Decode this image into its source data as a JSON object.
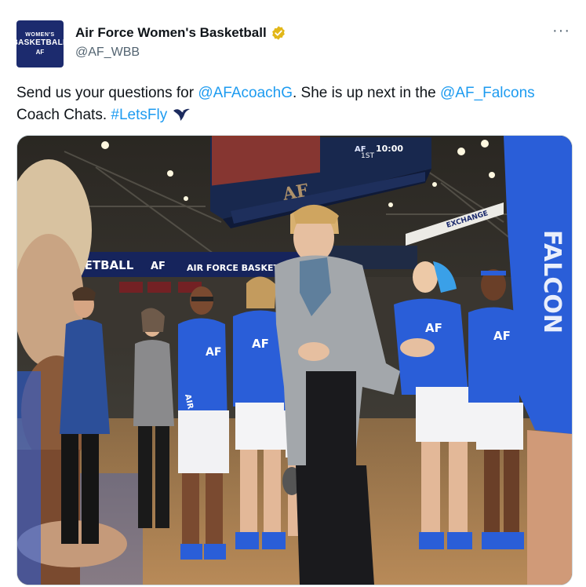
{
  "account": {
    "display_name": "Air Force Women's Basketball",
    "handle": "@AF_WBB",
    "verified": true,
    "avatar": {
      "line1": "WOMEN'S",
      "line2": "BASKETBALL",
      "line3": "AF"
    }
  },
  "tweet": {
    "text_1": "Send us your questions for ",
    "mention_1": "@AFAcoachG",
    "text_2": ". She is up next in the ",
    "mention_2": "@AF_Falcons",
    "text_3": " Coach Chats. ",
    "hashtag": "#LetsFly"
  },
  "media": {
    "scoreboard_time": "10:00",
    "scoreboard_period": "1ST",
    "scoreboard_logo": "AF",
    "banner_left": "KETBALL",
    "banner_logo": "AF",
    "banner_right": "AIR FORCE BASKETBALL",
    "exchange_sign": "EXCHANGE",
    "jersey_text": "AIR FORCE",
    "jersey_logo": "AF",
    "sleeve_text": "FALCON"
  },
  "icons": {
    "more": "more-icon",
    "verified": "verified-badge-icon",
    "falcon": "falcon-emoji-icon"
  },
  "colors": {
    "link": "#1d9bf0",
    "verified_gold": "#e2b719",
    "jersey_blue": "#2a5ed8"
  }
}
